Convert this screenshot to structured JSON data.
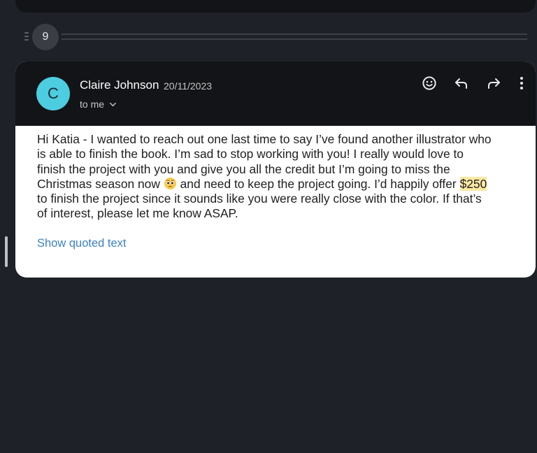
{
  "thread": {
    "collapsed_count": "9"
  },
  "message": {
    "avatar_initial": "C",
    "avatar_color": "#4ccde0",
    "sender_name": "Claire Johnson",
    "date": "20/11/2023",
    "recipient_label": "to me",
    "actions": {
      "emoji_icon": "smiley-icon",
      "reply_icon": "reply-icon",
      "forward_icon": "forward-icon",
      "more_icon": "more-vert-icon"
    },
    "body_lines": [
      "Hi Katia - I wanted to reach out one last time to say I’ve found another illustrator who",
      "is able to finish the book. I’m sad to stop working with you! I really would love to",
      "finish the project with you and give you all the credit but I’m going to miss the"
    ],
    "line4_before": "Christmas season now",
    "line4_emoji": "pleading-face-emoji",
    "line4_middle": " and need to keep the project going. I’d happily offer ",
    "line4_highlight": "$250",
    "body_lines_after": [
      "to finish the project since it sounds like you were really close with the color. If that’s",
      "of interest, please let me know ASAP."
    ],
    "highlight_color": "#fde7a3",
    "show_quoted_label": "Show quoted text",
    "link_color": "#3b82c4"
  }
}
